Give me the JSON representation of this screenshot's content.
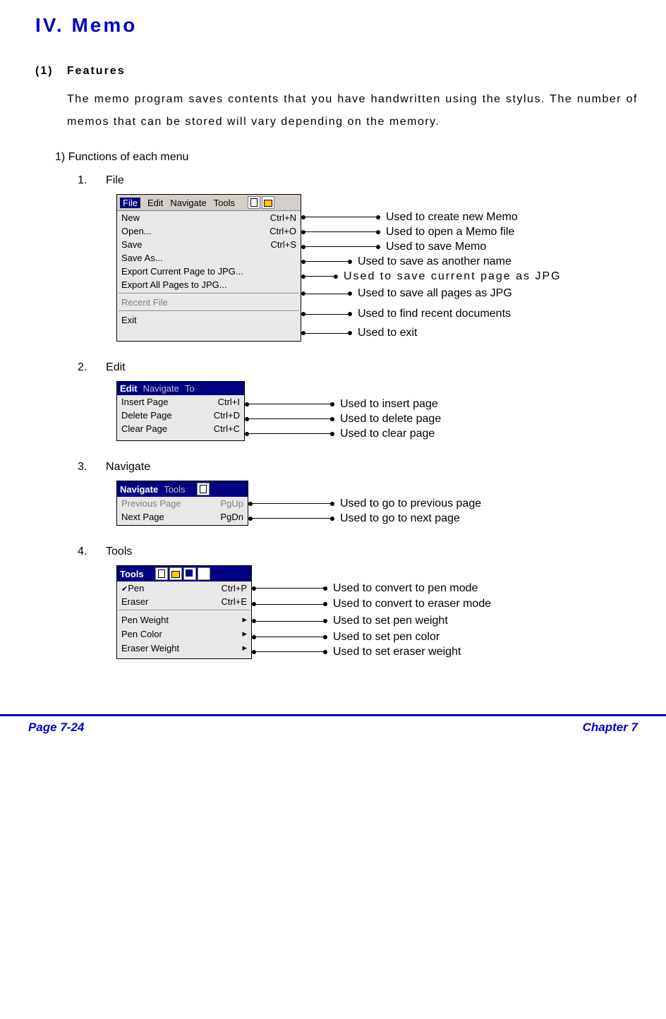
{
  "title": "IV.  Memo",
  "section1": {
    "num": "(1)",
    "label": "Features"
  },
  "paragraph": "The memo program saves contents that you have handwritten using the stylus. The number of memos that can be stored will vary depending on the memory.",
  "section2": "1)   Functions of each menu",
  "menus": {
    "file": {
      "num": "1.",
      "label": "File"
    },
    "edit": {
      "num": "2.",
      "label": "Edit"
    },
    "navigate": {
      "num": "3.",
      "label": "Navigate"
    },
    "tools": {
      "num": "4.",
      "label": "Tools"
    }
  },
  "filePanel": {
    "menubar": [
      "File",
      "Edit",
      "Navigate",
      "Tools"
    ],
    "items": [
      {
        "label": "New",
        "shortcut": "Ctrl+N",
        "annot": "Used to create new Memo"
      },
      {
        "label": "Open...",
        "shortcut": "Ctrl+O",
        "annot": "Used to open a Memo file"
      },
      {
        "label": "Save",
        "shortcut": "Ctrl+S",
        "annot": "Used to save Memo"
      },
      {
        "label": "Save As...",
        "shortcut": "",
        "annot": "Used to save as another name"
      },
      {
        "label": "Export Current Page to JPG...",
        "shortcut": "",
        "annot": "Used to save current page as JPG"
      },
      {
        "label": "Export All Pages to JPG...",
        "shortcut": "",
        "annot": "Used to save all pages as JPG"
      },
      {
        "label": "Recent File",
        "shortcut": "",
        "annot": "Used to find recent documents",
        "disabled": true
      },
      {
        "label": "Exit",
        "shortcut": "",
        "annot": "Used to exit"
      }
    ]
  },
  "editPanel": {
    "menubar": [
      "Edit",
      "Navigate",
      "To"
    ],
    "items": [
      {
        "label": "Insert Page",
        "shortcut": "Ctrl+I",
        "annot": "Used to insert page"
      },
      {
        "label": "Delete Page",
        "shortcut": "Ctrl+D",
        "annot": "Used to delete page"
      },
      {
        "label": "Clear Page",
        "shortcut": "Ctrl+C",
        "annot": "Used to clear page"
      }
    ]
  },
  "navPanel": {
    "menubar": [
      "Navigate",
      "Tools"
    ],
    "items": [
      {
        "label": "Previous Page",
        "shortcut": "PgUp",
        "annot": "Used to go to previous page"
      },
      {
        "label": "Next Page",
        "shortcut": "PgDn",
        "annot": "Used to go to next page"
      }
    ]
  },
  "toolsPanel": {
    "menubar": [
      "Tools"
    ],
    "items": [
      {
        "label": "Pen",
        "shortcut": "Ctrl+P",
        "annot": "Used to convert to pen mode",
        "checked": true
      },
      {
        "label": "Eraser",
        "shortcut": "Ctrl+E",
        "annot": "Used to convert to eraser mode"
      },
      {
        "label": "Pen Weight",
        "shortcut": "",
        "annot": "Used to set pen weight",
        "sep": true
      },
      {
        "label": "Pen Color",
        "shortcut": "",
        "annot": "Used to set pen color"
      },
      {
        "label": "Eraser Weight",
        "shortcut": "",
        "annot": "Used to set eraser weight"
      }
    ]
  },
  "footer": {
    "left": "Page 7-24",
    "right": "Chapter 7"
  }
}
